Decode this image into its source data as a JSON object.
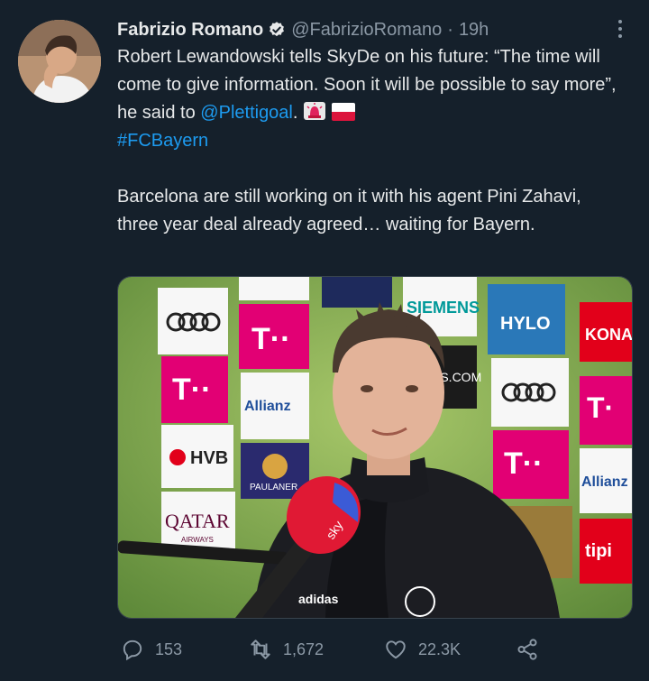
{
  "author": {
    "name": "Fabrizio Romano",
    "handle": "@FabrizioRomano",
    "separator": "·",
    "time": "19h"
  },
  "tweet": {
    "line1_before": "Robert Lewandowski tells SkyDe on his future: “The time will come to give information. Soon it will be possible to say more”, he said to ",
    "mention": "@Plettigoal",
    "period": ".",
    "hashtag": "#FCBayern",
    "paragraph2": "Barcelona are still working on it with his agent Pini Zahavi, three year deal already agreed… waiting for Bayern."
  },
  "media": {
    "ads": [
      "SIEMENS",
      "HYLO",
      "KONA",
      "Allianz",
      "HVB",
      "QATAR",
      "AIRWAYS",
      "PAULANER",
      "adidas",
      "tipi",
      "AS.COM",
      "sky"
    ]
  },
  "actions": {
    "reply_count": "153",
    "retweet_count": "1,672",
    "like_count": "22.3K"
  },
  "colors": {
    "background": "#15202b",
    "link": "#1d9bf0",
    "muted": "#8b98a5"
  },
  "icons": [
    "verified-badge-icon",
    "more-icon",
    "emoji-siren",
    "emoji-flag-poland",
    "reply-icon",
    "retweet-icon",
    "like-icon",
    "share-icon"
  ]
}
